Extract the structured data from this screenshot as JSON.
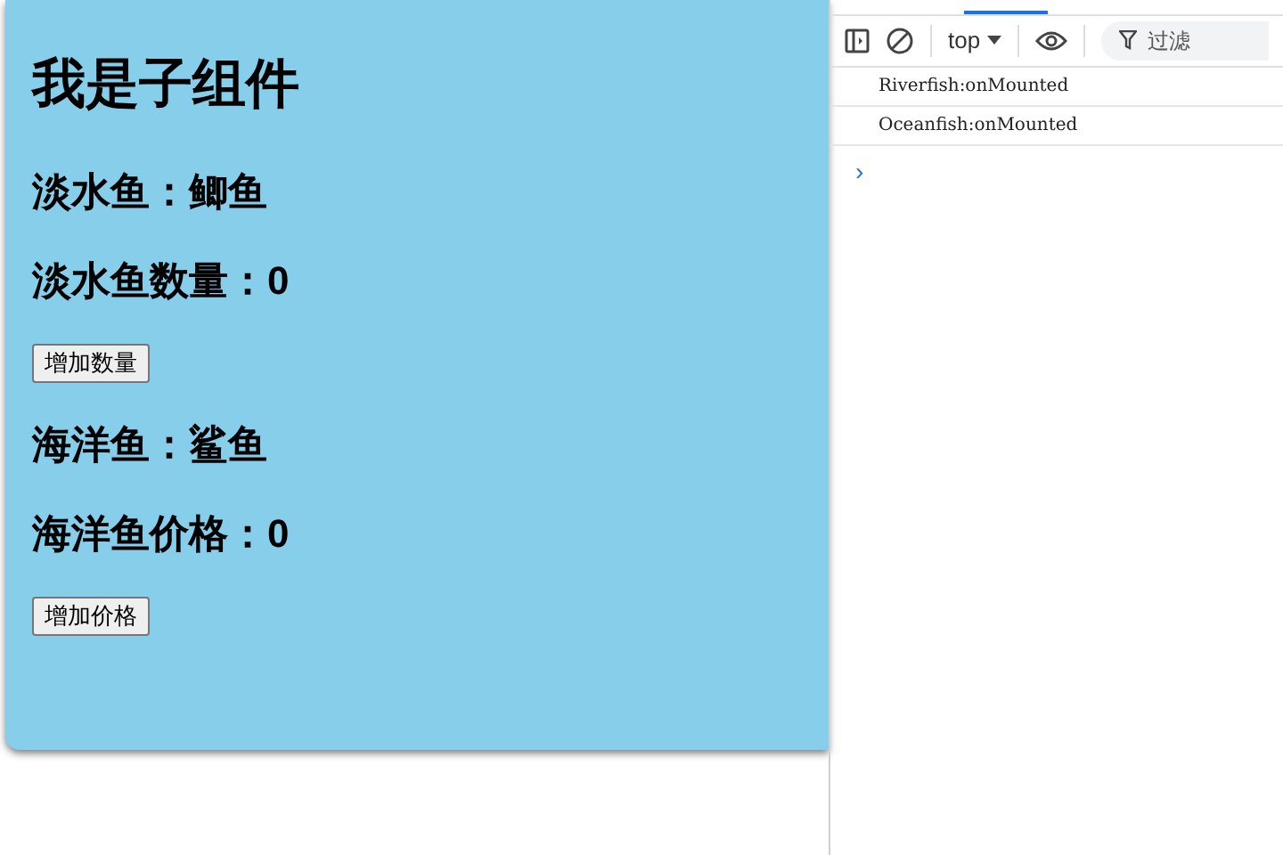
{
  "child_component": {
    "title": "我是子组件",
    "items": [
      {
        "kind": "text",
        "text": "淡水鱼：鲫鱼"
      },
      {
        "kind": "text",
        "text": "淡水鱼数量：0"
      },
      {
        "kind": "button",
        "text": "增加数量"
      },
      {
        "kind": "text",
        "text": "海洋鱼：鲨鱼"
      },
      {
        "kind": "text",
        "text": "海洋鱼价格：0"
      },
      {
        "kind": "button",
        "text": "增加价格"
      }
    ]
  },
  "devtools": {
    "context": "top",
    "filter": {
      "placeholder": "过滤"
    },
    "messages": [
      "Riverfish:onMounted",
      "Oceanfish:onMounted"
    ],
    "prompt": "›"
  }
}
